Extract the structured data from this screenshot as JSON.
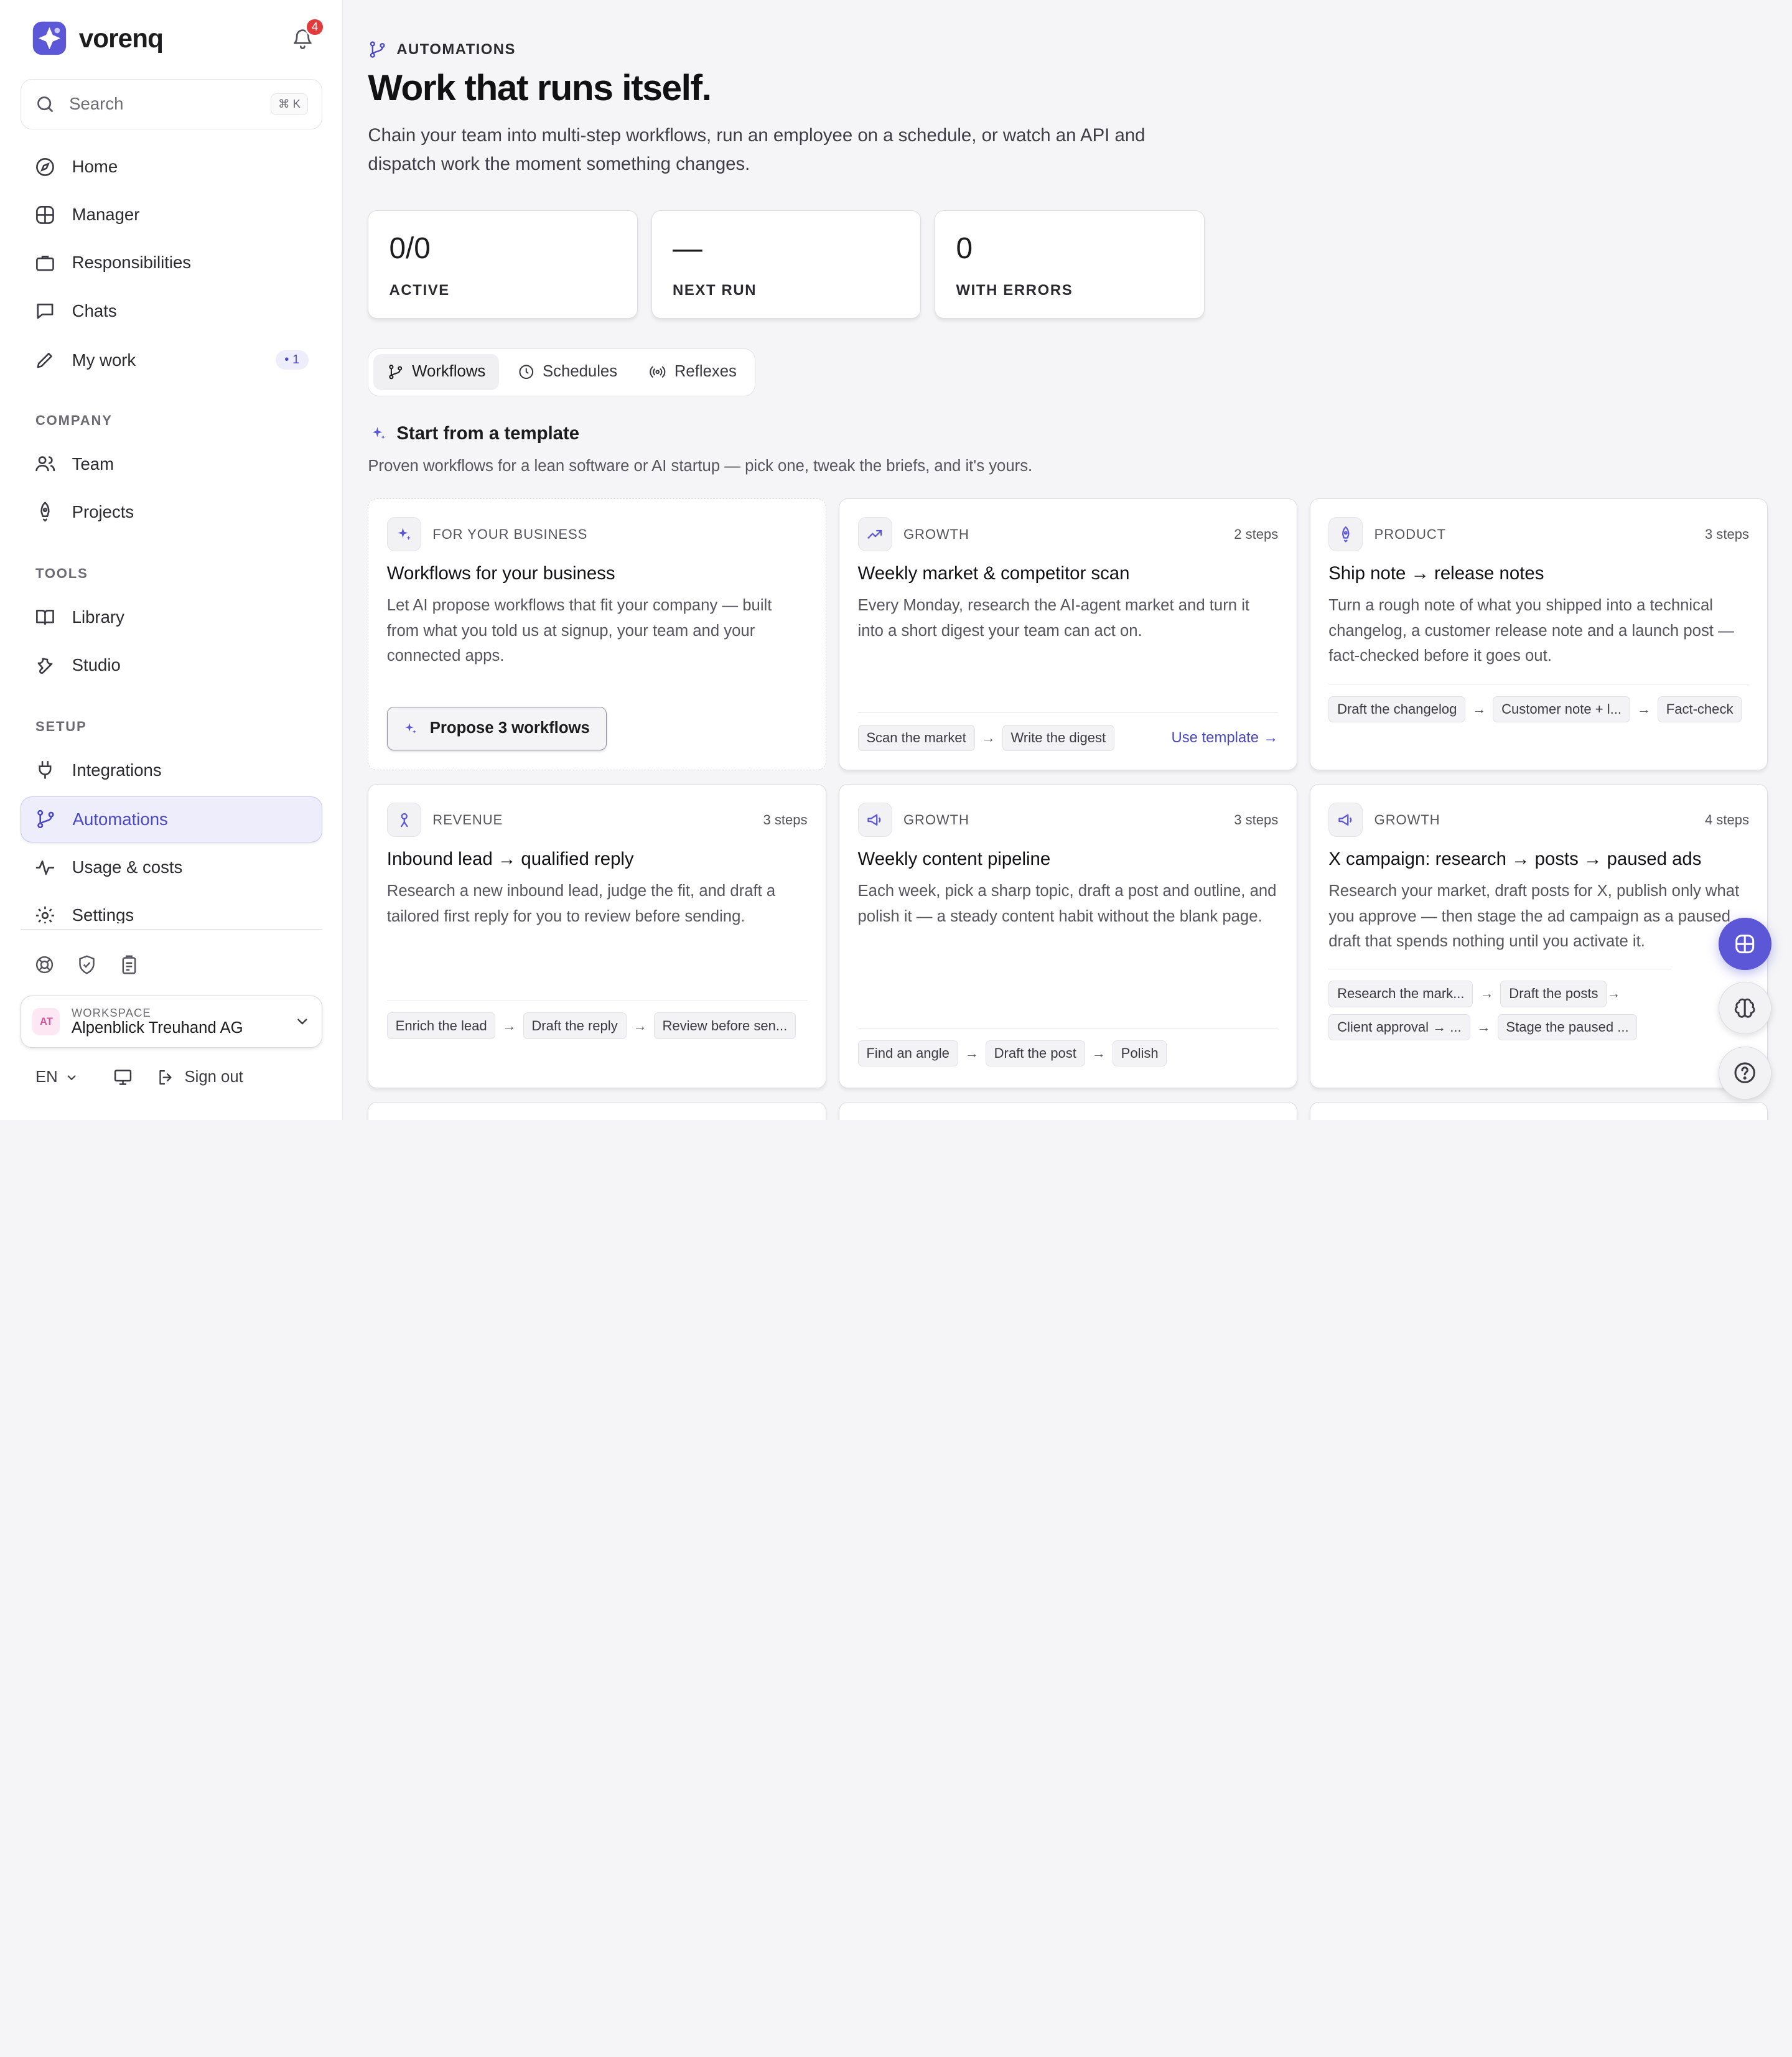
{
  "brand": {
    "name": "vorenq",
    "notification_count": "4"
  },
  "search": {
    "label": "Search",
    "shortcut": "⌘ K"
  },
  "nav": {
    "home": "Home",
    "manager": "Manager",
    "responsibilities": "Responsibilities",
    "chats": "Chats",
    "my_work": "My work",
    "my_work_count": "• 1",
    "company_label": "COMPANY",
    "team": "Team",
    "projects": "Projects",
    "tools_label": "TOOLS",
    "library": "Library",
    "studio": "Studio",
    "setup_label": "SETUP",
    "integrations": "Integrations",
    "automations": "Automations",
    "usage": "Usage & costs",
    "settings": "Settings"
  },
  "workspace": {
    "initials": "AT",
    "label": "WORKSPACE",
    "name": "Alpenblick Treuhand AG"
  },
  "footer": {
    "language": "EN",
    "sign_out": "Sign out"
  },
  "page": {
    "eyebrow": "AUTOMATIONS",
    "title": "Work that runs itself.",
    "description": "Chain your team into multi-step workflows, run an employee on a schedule, or watch an API and dispatch work the moment something changes."
  },
  "stats": [
    {
      "value": "0/0",
      "label": "ACTIVE"
    },
    {
      "value": "—",
      "label": "NEXT RUN"
    },
    {
      "value": "0",
      "label": "WITH ERRORS"
    }
  ],
  "tabs": [
    "Workflows",
    "Schedules",
    "Reflexes"
  ],
  "templates": {
    "heading": "Start from a template",
    "subtitle": "Proven workflows for a lean software or AI startup — pick one, tweak the briefs, and it's yours.",
    "business_card": {
      "category": "FOR YOUR BUSINESS",
      "title": "Workflows for your business",
      "description": "Let AI propose workflows that fit your company — built from what you told us at signup, your team and your connected apps.",
      "button": "Propose 3 workflows"
    },
    "use_template": "Use template",
    "cards": [
      {
        "category": "GROWTH",
        "steps": "2 steps",
        "title": "Weekly market & competitor scan",
        "description": "Every Monday, research the AI-agent market and turn it into a short digest your team can act on.",
        "chips": [
          "Scan the market",
          "Write the digest"
        ]
      },
      {
        "category": "PRODUCT",
        "steps": "3 steps",
        "title": "Ship note → release notes",
        "description": "Turn a rough note of what you shipped into a technical changelog, a customer release note and a launch post — fact-checked before it goes out.",
        "chips": [
          "Draft the changelog",
          "Customer note + l...",
          "Fact-check"
        ]
      },
      {
        "category": "REVENUE",
        "steps": "3 steps",
        "title": "Inbound lead → qualified reply",
        "description": "Research a new inbound lead, judge the fit, and draft a tailored first reply for you to review before sending.",
        "chips": [
          "Enrich the lead",
          "Draft the reply",
          "Review before sen..."
        ]
      },
      {
        "category": "GROWTH",
        "steps": "3 steps",
        "title": "Weekly content pipeline",
        "description": "Each week, pick a sharp topic, draft a post and outline, and polish it — a steady content habit without the blank page.",
        "chips": [
          "Find an angle",
          "Draft the post",
          "Polish"
        ]
      },
      {
        "category": "GROWTH",
        "steps": "4 steps",
        "title": "X campaign: research → posts → paused ads",
        "description": "Research your market, draft posts for X, publish only what you approve — then stage the ad campaign as a paused draft that spends nothing until you activate it.",
        "chips": [
          "Research the mark...",
          "Draft the posts",
          "Client approval → ...",
          "Stage the paused ..."
        ]
      }
    ]
  },
  "colors": {
    "accent": "#5b57d6",
    "accent_text": "#4a48c2",
    "badge": "#e23b3b"
  }
}
